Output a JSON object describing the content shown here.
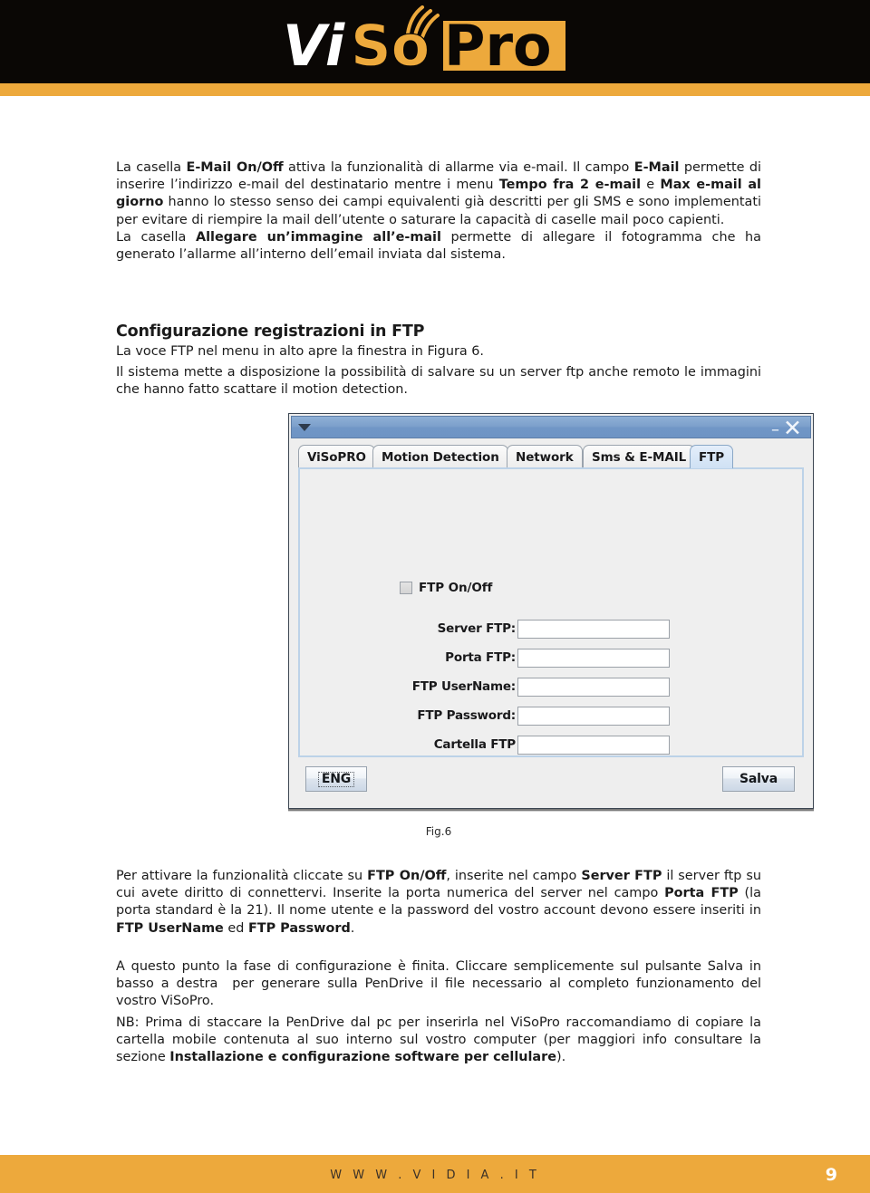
{
  "header": {
    "logo_alt": "ViSoPro",
    "logo_part_1": "Vi",
    "logo_part_2": "So",
    "logo_part_3": "Pro",
    "band_color": "#0a0705",
    "accent_color": "#eda93c"
  },
  "content": {
    "para_1_html": "La casella <b>E-Mail On/Off</b> attiva la funzionalità di allarme via e-mail. Il campo <b>E-Mail</b> permette di inserire l’indirizzo e-mail del destinatario mentre i menu <b>Tempo fra 2 e-mail</b> e <b>Max e-mail al giorno</b> hanno lo stesso senso dei campi equivalenti già descritti per gli SMS e sono implementati per evitare di riempire la mail dell’utente o saturare la capacità di caselle mail poco capienti.<br>La casella <b>Allegare un’immagine all’e-mail</b> permette di allegare il fotogramma che ha generato l’allarme all’interno dell’email inviata dal sistema.",
    "section_heading": "Configurazione registrazioni in FTP",
    "para_2_html": "La voce FTP nel menu in alto apre la finestra in Figura 6.",
    "para_3_html": "Il sistema mette a disposizione la possibilità di salvare su un server ftp anche remoto le immagini che hanno fatto scattare il motion detection.",
    "figure_caption": "Fig.6",
    "para_4_html": "Per attivare la funzionalità cliccate su <b>FTP On/Off</b>, inserite nel campo <b>Server FTP</b> il server ftp su cui avete diritto di connettervi. Inserite la porta numerica del server nel campo <b>Porta FTP</b> (la porta standard è la 21). Il nome utente e la password del vostro account devono essere inseriti in <b>FTP UserName</b> ed <b>FTP Password</b>.",
    "para_5_html": "A questo punto la fase di configurazione è finita. Cliccare semplicemente sul pulsante Salva in basso a destra &nbsp;per generare sulla PenDrive il file necessario al completo funzionamento del vostro ViSoPro.",
    "para_6_html": "NB: Prima di staccare la PenDrive dal pc per inserirla nel ViSoPro raccomandiamo di copiare la cartella mobile contenuta al suo interno sul vostro computer (per maggiori info consultare la sezione <b>Installazione e configurazione software per cellulare</b>)."
  },
  "figure": {
    "dialog": {
      "titlebar": {
        "menu_arrow_icon": "chevron-down-icon",
        "minimize_label": "–",
        "close_label": "✕"
      },
      "tabs": [
        {
          "label": "ViSoPRO",
          "active": false
        },
        {
          "label": "Motion Detection",
          "active": false
        },
        {
          "label": "Network",
          "active": false
        },
        {
          "label": "Sms & E-MAIL",
          "active": false
        },
        {
          "label": "FTP",
          "active": true
        }
      ],
      "checkbox": {
        "label": "FTP On/Off",
        "checked": false
      },
      "fields": [
        {
          "label": "Server FTP:",
          "value": "",
          "placeholder": ""
        },
        {
          "label": "Porta FTP:",
          "value": "",
          "placeholder": ""
        },
        {
          "label": "FTP UserName:",
          "value": "",
          "placeholder": ""
        },
        {
          "label": "FTP Password:",
          "value": "",
          "placeholder": ""
        },
        {
          "label": "Cartella FTP",
          "value": "",
          "placeholder": ""
        }
      ],
      "buttons": {
        "language": "ENG",
        "save": "Salva"
      },
      "titlebar_color": "#7b9fcb",
      "panel_border_color": "#bcd2e8"
    }
  },
  "footer": {
    "website": "W W W . V I D I A . I T",
    "page_number": "9"
  }
}
